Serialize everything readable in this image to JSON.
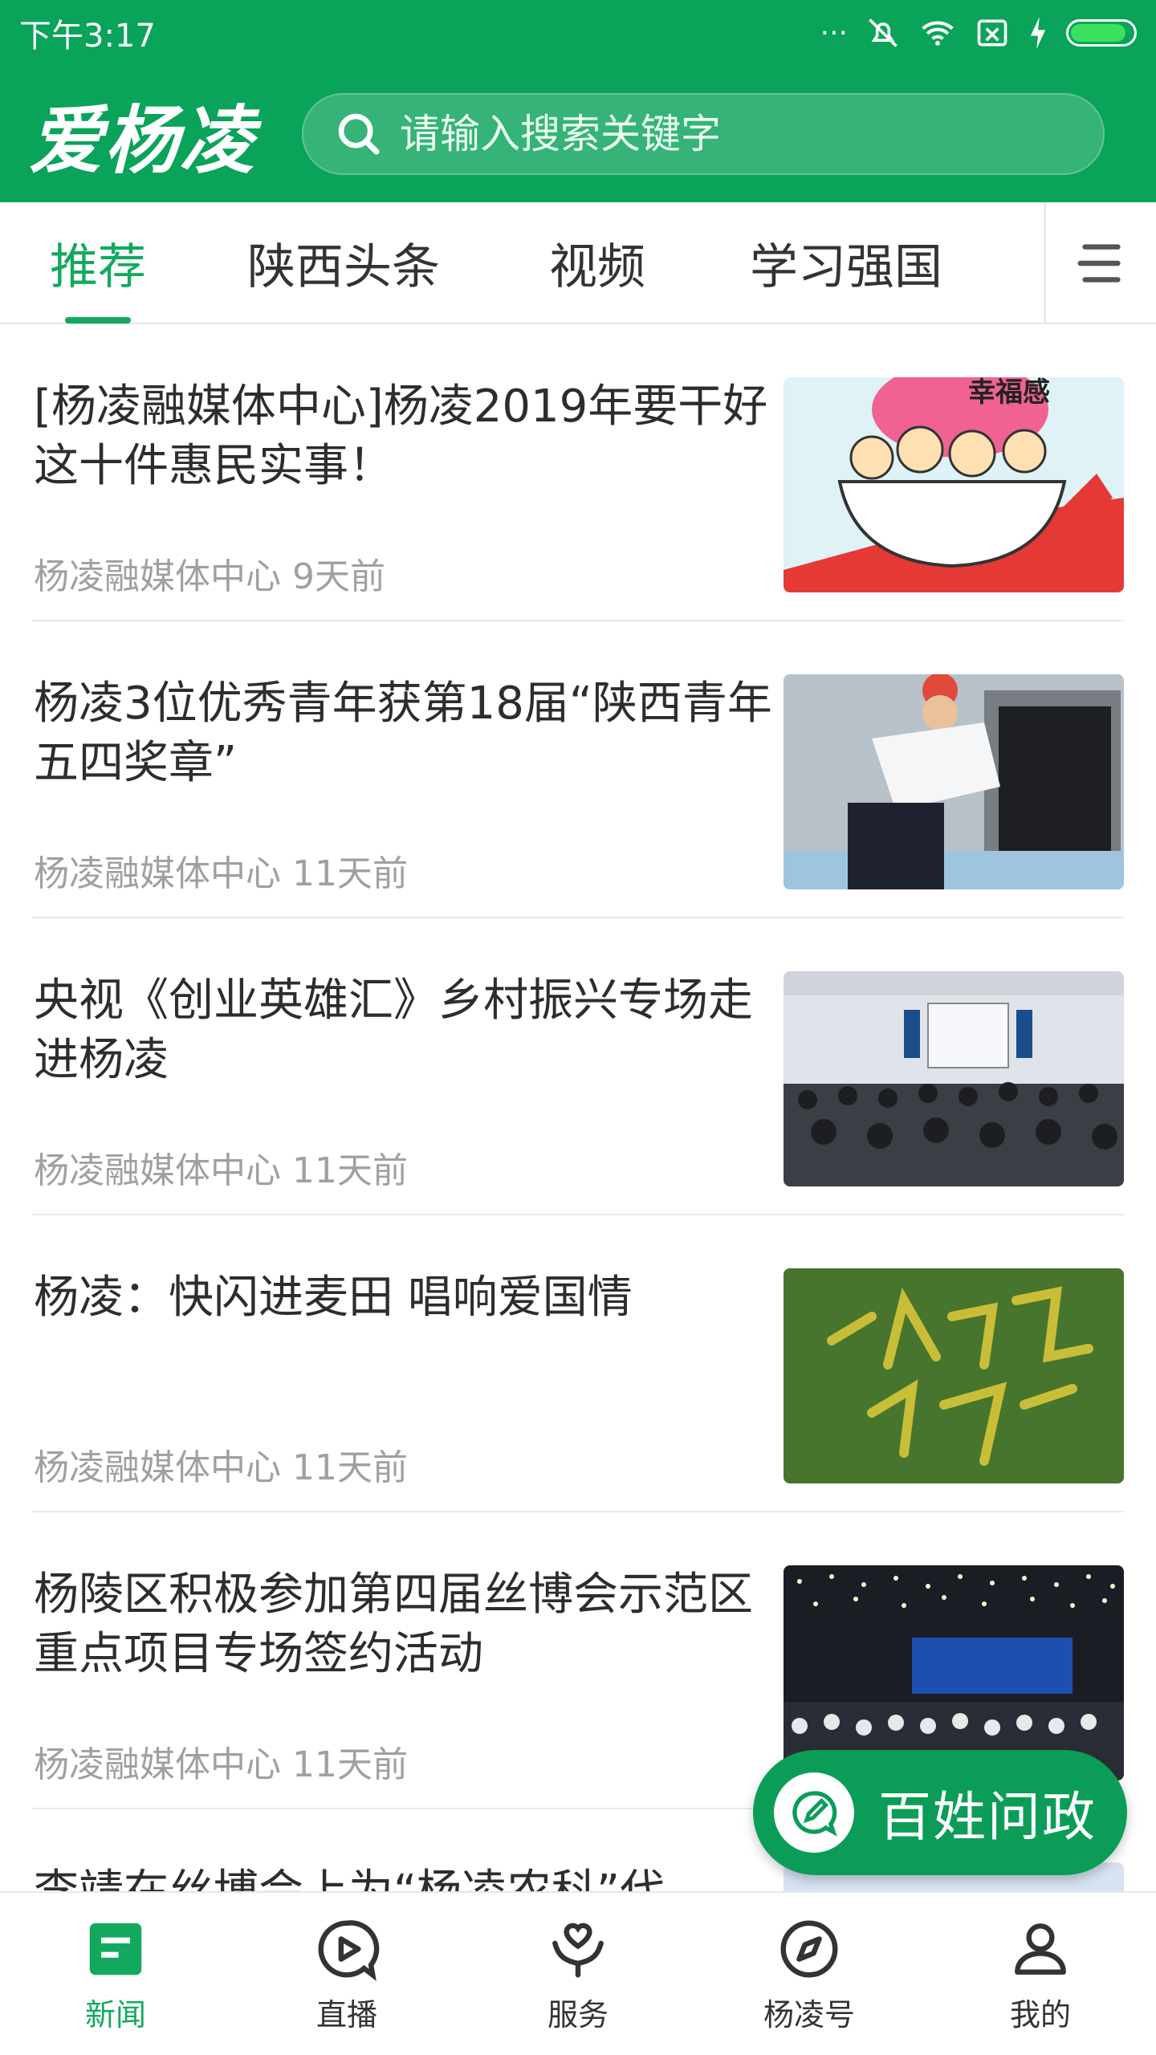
{
  "status": {
    "time": "下午3:17",
    "dots": "···",
    "battery_level": 0.9
  },
  "app": {
    "logo_text": "爱杨凌"
  },
  "search": {
    "placeholder": "请输入搜索关键字"
  },
  "tabs": [
    {
      "label": "推荐",
      "active": true
    },
    {
      "label": "陕西头条"
    },
    {
      "label": "视频"
    },
    {
      "label": "学习强国"
    }
  ],
  "feed": [
    {
      "title": "[杨凌融媒体中心]杨凌2019年要干好这十件惠民实事！",
      "source": "杨凌融媒体中心",
      "time": "9天前"
    },
    {
      "title": "杨凌3位优秀青年获第18届“陕西青年五四奖章”",
      "source": "杨凌融媒体中心",
      "time": "11天前"
    },
    {
      "title": "央视《创业英雄汇》乡村振兴专场走进杨凌",
      "source": "杨凌融媒体中心",
      "time": "11天前"
    },
    {
      "title": "杨凌：快闪进麦田 唱响爱国情",
      "source": "杨凌融媒体中心",
      "time": "11天前"
    },
    {
      "title": "杨陵区积极参加第四届丝博会示范区重点项目专场签约活动",
      "source": "杨凌融媒体中心",
      "time": "11天前"
    },
    {
      "title": "李靖在丝博会上为“杨凌农科”代",
      "source": "",
      "time": ""
    }
  ],
  "thumb_texts": {
    "happiness": "幸福感"
  },
  "fab": {
    "label": "百姓问政"
  },
  "bottom_nav": [
    {
      "label": "新闻",
      "active": true
    },
    {
      "label": "直播"
    },
    {
      "label": "服务"
    },
    {
      "label": "杨凌号"
    },
    {
      "label": "我的"
    }
  ],
  "colors": {
    "primary": "#0aa35a",
    "tab_active": "#12a95f",
    "meta_text": "#a0a0a0"
  }
}
